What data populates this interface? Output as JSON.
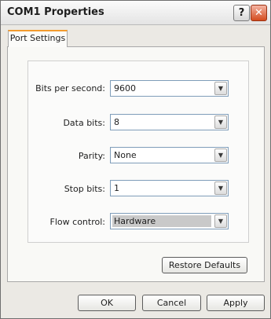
{
  "window": {
    "title": "COM1 Properties"
  },
  "titlebar": {
    "help_glyph": "?",
    "close_glyph": "✕"
  },
  "tabs": [
    {
      "label": "Port Settings"
    }
  ],
  "fields": [
    {
      "label": "Bits per second:",
      "value": "9600"
    },
    {
      "label": "Data bits:",
      "value": "8"
    },
    {
      "label": "Parity:",
      "value": "None"
    },
    {
      "label": "Stop bits:",
      "value": "1"
    },
    {
      "label": "Flow control:",
      "value": "Hardware"
    }
  ],
  "buttons": {
    "restore_defaults": "Restore Defaults",
    "ok": "OK",
    "cancel": "Cancel",
    "apply": "Apply"
  },
  "icons": {
    "dropdown_arrow": "chevron-down-icon"
  }
}
